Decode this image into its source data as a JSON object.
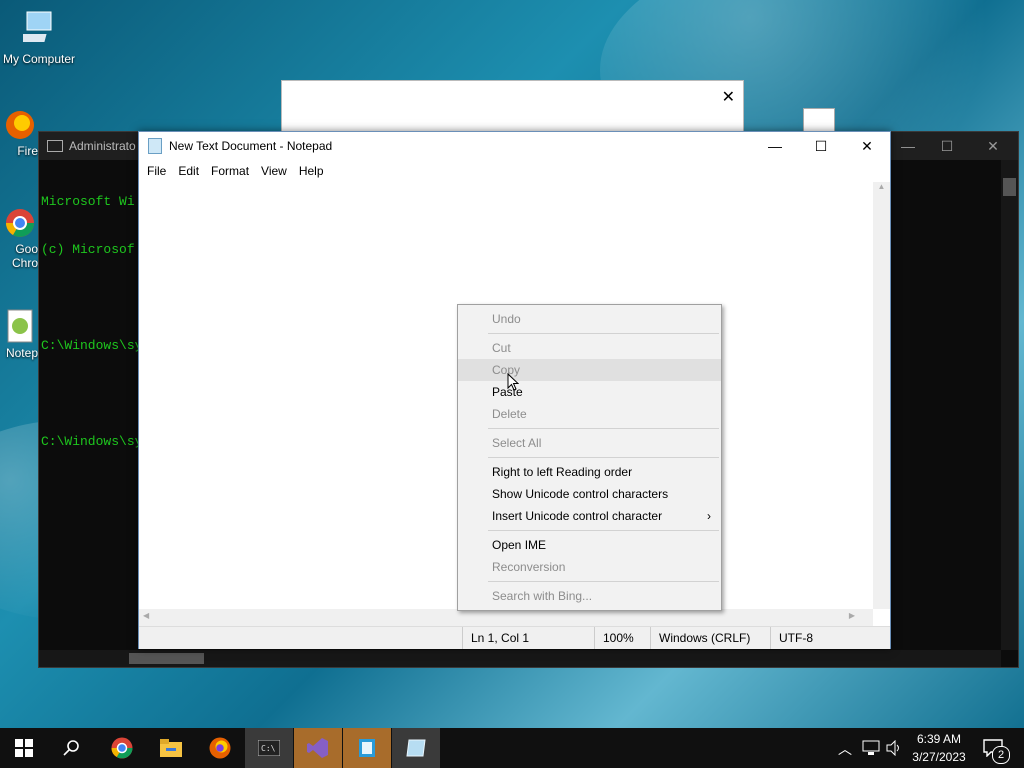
{
  "desktop": {
    "icons": [
      {
        "label": "My Computer",
        "icon": "computer-icon"
      },
      {
        "label": "Fire",
        "icon": "firefox-icon"
      },
      {
        "label": "Goo",
        "icon": "chrome-icon"
      },
      {
        "label": "Chro",
        "icon": "chrome-icon"
      },
      {
        "label": "Notep",
        "icon": "notepadpp-icon"
      }
    ]
  },
  "cmd": {
    "title": "Administrato",
    "lines": [
      "Microsoft Wi",
      "(c) Microsof",
      "",
      "C:\\Windows\\sy",
      "",
      "C:\\Windows\\sy"
    ]
  },
  "notepad": {
    "title": "New Text Document - Notepad",
    "menu": [
      "File",
      "Edit",
      "Format",
      "View",
      "Help"
    ],
    "status": {
      "position": "Ln 1, Col 1",
      "zoom": "100%",
      "line_ending": "Windows (CRLF)",
      "encoding": "UTF-8"
    }
  },
  "context_menu": {
    "items": [
      {
        "label": "Undo",
        "enabled": false
      },
      {
        "label": "Cut",
        "enabled": false
      },
      {
        "label": "Copy",
        "enabled": false,
        "hovered": true
      },
      {
        "label": "Paste",
        "enabled": true
      },
      {
        "label": "Delete",
        "enabled": false
      },
      {
        "label": "Select All",
        "enabled": false
      },
      {
        "label": "Right to left Reading order",
        "enabled": true
      },
      {
        "label": "Show Unicode control characters",
        "enabled": true
      },
      {
        "label": "Insert Unicode control character",
        "enabled": true,
        "submenu": true
      },
      {
        "label": "Open IME",
        "enabled": true
      },
      {
        "label": "Reconversion",
        "enabled": false
      },
      {
        "label": "Search with Bing...",
        "enabled": false
      }
    ]
  },
  "taskbar": {
    "time": "6:39 AM",
    "date": "3/27/2023",
    "notification_count": "2"
  },
  "colors": {
    "cmd_text": "#1ec61e",
    "taskbar": "#101010",
    "disabled_text": "#8d8d8d"
  }
}
